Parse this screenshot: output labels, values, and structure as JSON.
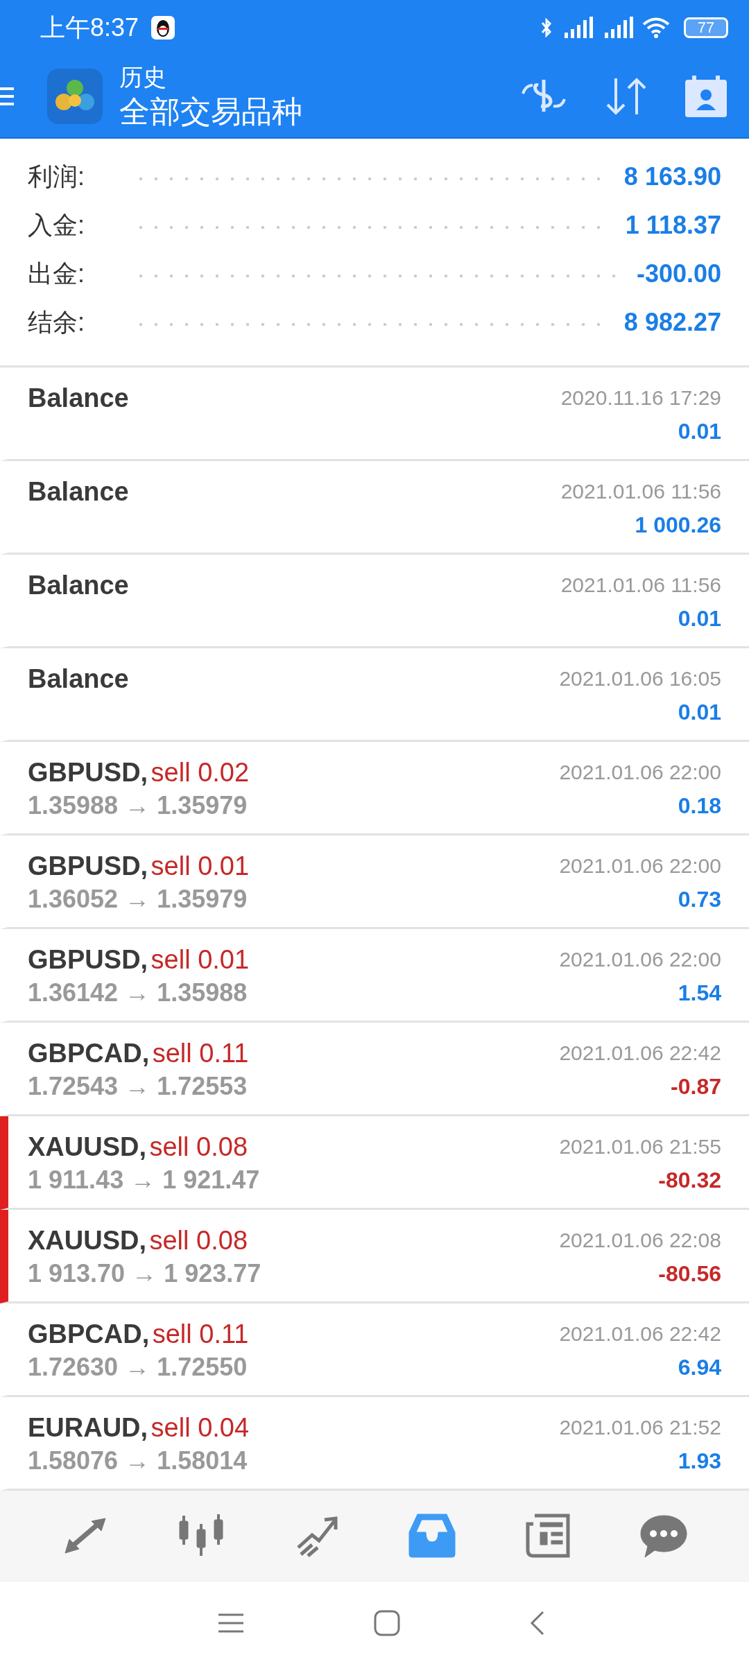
{
  "status_bar": {
    "time": "上午8:37",
    "battery": "77"
  },
  "app_bar": {
    "title": "历史",
    "subtitle": "全部交易品种"
  },
  "summary": [
    {
      "label": "利润:",
      "value": "8 163.90"
    },
    {
      "label": "入金:",
      "value": "1 118.37"
    },
    {
      "label": "出金:",
      "value": "-300.00"
    },
    {
      "label": "结余:",
      "value": "8 982.27"
    }
  ],
  "records": [
    {
      "kind": "balance",
      "title": "Balance",
      "time": "2020.11.16 17:29",
      "profit": "0.01",
      "loss": false,
      "flagged": false
    },
    {
      "kind": "balance",
      "title": "Balance",
      "time": "2021.01.06 11:56",
      "profit": "1 000.26",
      "loss": false,
      "flagged": false
    },
    {
      "kind": "balance",
      "title": "Balance",
      "time": "2021.01.06 11:56",
      "profit": "0.01",
      "loss": false,
      "flagged": false
    },
    {
      "kind": "balance",
      "title": "Balance",
      "time": "2021.01.06 16:05",
      "profit": "0.01",
      "loss": false,
      "flagged": false
    },
    {
      "kind": "trade",
      "symbol": "GBPUSD,",
      "order": "sell 0.02",
      "prices": "1.35988 → 1.35979",
      "time": "2021.01.06 22:00",
      "profit": "0.18",
      "loss": false,
      "flagged": false
    },
    {
      "kind": "trade",
      "symbol": "GBPUSD,",
      "order": "sell 0.01",
      "prices": "1.36052 → 1.35979",
      "time": "2021.01.06 22:00",
      "profit": "0.73",
      "loss": false,
      "flagged": false
    },
    {
      "kind": "trade",
      "symbol": "GBPUSD,",
      "order": "sell 0.01",
      "prices": "1.36142 → 1.35988",
      "time": "2021.01.06 22:00",
      "profit": "1.54",
      "loss": false,
      "flagged": false
    },
    {
      "kind": "trade",
      "symbol": "GBPCAD,",
      "order": "sell 0.11",
      "prices": "1.72543 → 1.72553",
      "time": "2021.01.06 22:42",
      "profit": "-0.87",
      "loss": true,
      "flagged": false
    },
    {
      "kind": "trade",
      "symbol": "XAUUSD,",
      "order": "sell 0.08",
      "prices": "1 911.43 → 1 921.47",
      "time": "2021.01.06 21:55",
      "profit": "-80.32",
      "loss": true,
      "flagged": true
    },
    {
      "kind": "trade",
      "symbol": "XAUUSD,",
      "order": "sell 0.08",
      "prices": "1 913.70 → 1 923.77",
      "time": "2021.01.06 22:08",
      "profit": "-80.56",
      "loss": true,
      "flagged": true
    },
    {
      "kind": "trade",
      "symbol": "GBPCAD,",
      "order": "sell 0.11",
      "prices": "1.72630 → 1.72550",
      "time": "2021.01.06 22:42",
      "profit": "6.94",
      "loss": false,
      "flagged": false
    },
    {
      "kind": "trade",
      "symbol": "EURAUD,",
      "order": "sell 0.04",
      "prices": "1.58076 → 1.58014",
      "time": "2021.01.06 21:52",
      "profit": "1.93",
      "loss": false,
      "flagged": false
    }
  ],
  "bottom_nav": [
    {
      "kind": "quotes",
      "selected": false
    },
    {
      "kind": "chart",
      "selected": false
    },
    {
      "kind": "trade",
      "selected": false
    },
    {
      "kind": "history",
      "selected": true
    },
    {
      "kind": "news",
      "selected": false
    },
    {
      "kind": "chat",
      "selected": false
    }
  ]
}
